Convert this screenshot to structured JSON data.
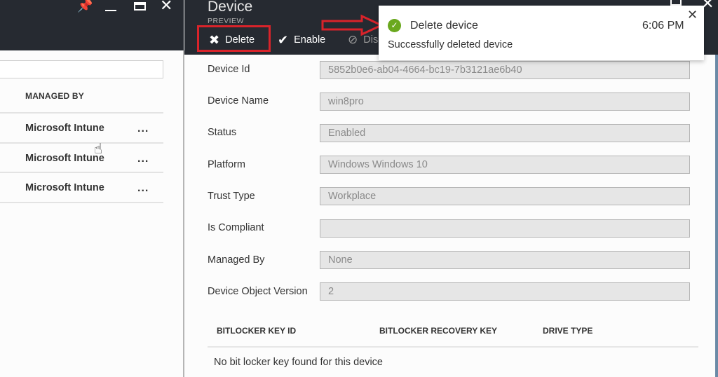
{
  "left_blade": {
    "window_controls": {
      "pin": "pin-icon",
      "minimize": "minimize-icon",
      "maximize": "maximize-icon",
      "close": "close-icon"
    },
    "filter_placeholder": "",
    "column_header": "MANAGED BY",
    "rows": [
      {
        "managed_by": "Microsoft Intune",
        "more": "..."
      },
      {
        "managed_by": "Microsoft Intune",
        "more": "..."
      },
      {
        "managed_by": "Microsoft Intune",
        "more": "..."
      }
    ]
  },
  "device_blade": {
    "title": "Device",
    "subtitle": "PREVIEW",
    "commands": [
      {
        "label": "Delete",
        "icon": "x-icon"
      },
      {
        "label": "Enable",
        "icon": "checkmark-icon"
      },
      {
        "label": "Disable",
        "icon": "disable-icon"
      }
    ],
    "fields": [
      {
        "label": "Device Id",
        "value": "5852b0e6-ab04-4664-bc19-7b3121ae6b40"
      },
      {
        "label": "Device Name",
        "value": "win8pro"
      },
      {
        "label": "Status",
        "value": "Enabled"
      },
      {
        "label": "Platform",
        "value": "Windows Windows 10"
      },
      {
        "label": "Trust Type",
        "value": "Workplace"
      },
      {
        "label": "Is Compliant",
        "value": ""
      },
      {
        "label": "Managed By",
        "value": "None"
      },
      {
        "label": "Device Object Version",
        "value": "2"
      }
    ],
    "bitlocker": {
      "columns": [
        "BITLOCKER KEY ID",
        "BITLOCKER RECOVERY KEY",
        "DRIVE TYPE"
      ],
      "empty_message": "No bit locker key found for this device"
    }
  },
  "notification": {
    "title": "Delete device",
    "time": "6:06 PM",
    "message": "Successfully deleted device",
    "status_color": "#6aa81e"
  },
  "annotations": {
    "highlight_color": "#d9232a"
  }
}
